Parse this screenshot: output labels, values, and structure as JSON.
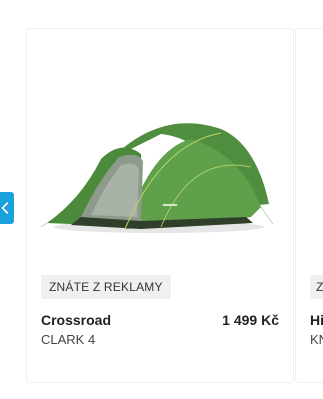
{
  "product": {
    "badge": "ZNÁTE Z REKLAMY",
    "brand": "Crossroad",
    "model": "CLARK 4",
    "price": "1 499 Kč",
    "image_alt": "green dome tent"
  },
  "next_product": {
    "badge": "ZNÁTE Z REKLAMY",
    "brand": "Hi",
    "model": "KN"
  },
  "carousel": {
    "prev_icon": "chevron-left-icon",
    "accent": "#1aa0dc"
  },
  "colors": {
    "tent_green": "#5a9a48",
    "tent_dark": "#3f7a33",
    "badge_bg": "#f0f0f0"
  }
}
